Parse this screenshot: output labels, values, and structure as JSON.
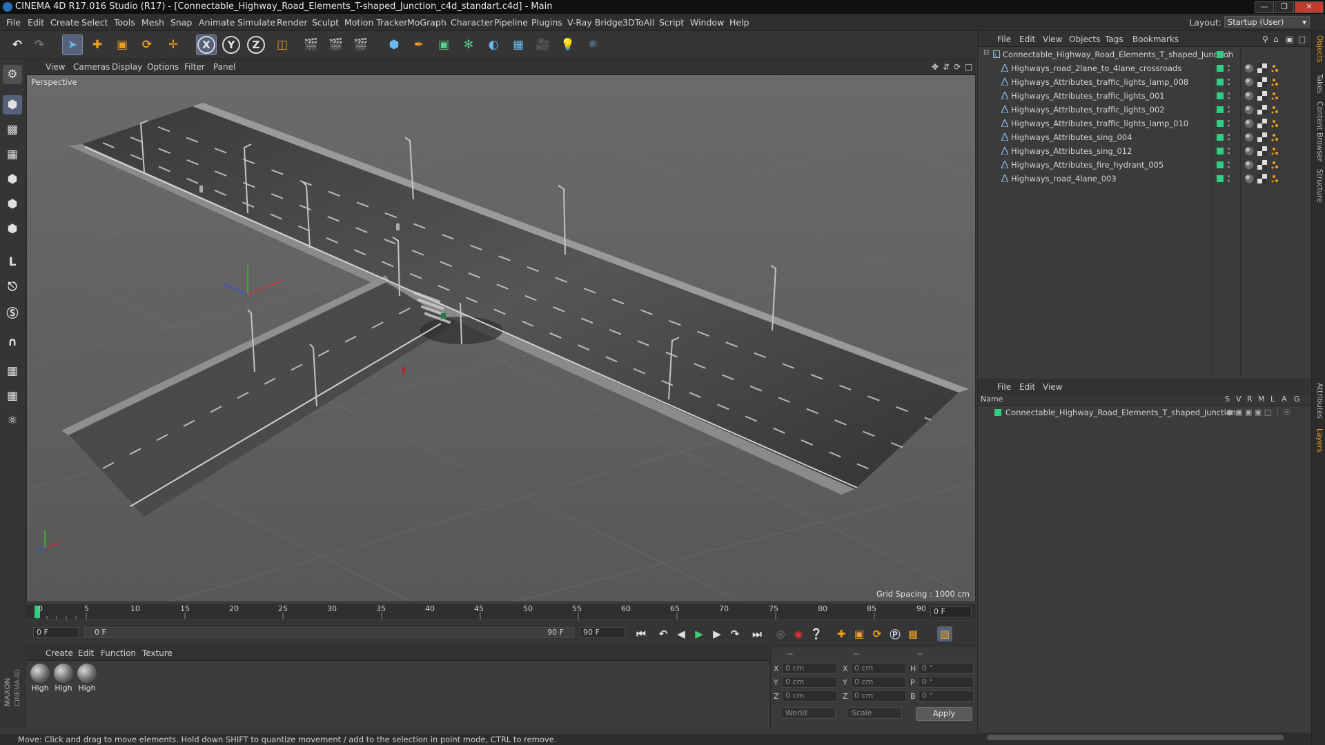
{
  "window": {
    "title": "CINEMA 4D R17.016 Studio (R17) - [Connectable_Highway_Road_Elements_T-shaped_Junction_c4d_standart.c4d] - Main"
  },
  "menubar": {
    "items": [
      "File",
      "Edit",
      "Create",
      "Select",
      "Tools",
      "Mesh",
      "Snap",
      "Animate",
      "Simulate",
      "Render",
      "Sculpt",
      "Motion Tracker",
      "MoGraph",
      "Character",
      "Pipeline",
      "Plugins",
      "V-Ray Bridge",
      "3DToAll",
      "Script",
      "Window",
      "Help"
    ],
    "layout_label": "Layout:",
    "layout_value": "Startup (User)"
  },
  "toolbar": {
    "axis_x": "X",
    "axis_y": "Y",
    "axis_z": "Z"
  },
  "viewport": {
    "menu": [
      "View",
      "Cameras",
      "Display",
      "Options",
      "Filter",
      "Panel"
    ],
    "camera_label": "Perspective",
    "grid_spacing": "Grid Spacing : 1000 cm"
  },
  "timeline": {
    "ticks": [
      "0",
      "5",
      "10",
      "15",
      "20",
      "25",
      "30",
      "35",
      "40",
      "45",
      "50",
      "55",
      "60",
      "65",
      "70",
      "75",
      "80",
      "85",
      "90"
    ],
    "end_field": "0 F",
    "start_frame": "0 F",
    "range_start": "0 F",
    "range_end": "90 F",
    "end_frame": "90 F"
  },
  "materials": {
    "menu": [
      "Create",
      "Edit",
      "Function",
      "Texture"
    ],
    "items": [
      {
        "label": "High"
      },
      {
        "label": "High"
      },
      {
        "label": "High"
      }
    ]
  },
  "coordinates": {
    "header": [
      "--",
      "--",
      "--"
    ],
    "rows": [
      {
        "a": "X",
        "av": "0 cm",
        "b": "X",
        "bv": "0 cm",
        "c": "H",
        "cv": "0 °"
      },
      {
        "a": "Y",
        "av": "0 cm",
        "b": "Y",
        "bv": "0 cm",
        "c": "P",
        "cv": "0 °"
      },
      {
        "a": "Z",
        "av": "0 cm",
        "b": "Z",
        "bv": "0 cm",
        "c": "B",
        "cv": "0 °"
      }
    ],
    "mode": "World",
    "scale": "Scale",
    "apply": "Apply"
  },
  "objects_panel": {
    "menu": [
      "File",
      "Edit",
      "View",
      "Objects",
      "Tags",
      "Bookmarks"
    ],
    "root": "Connectable_Highway_Road_Elements_T_shaped_Junction",
    "children": [
      "Highways_road_2lane_to_4lane_crossroads",
      "Highways_Attributes_traffic_lights_lamp_008",
      "Highways_Attributes_traffic_lights_001",
      "Highways_Attributes_traffic_lights_002",
      "Highways_Attributes_traffic_lights_lamp_010",
      "Highways_Attributes_sing_004",
      "Highways_Attributes_sing_012",
      "Highways_Attributes_fire_hydrant_005",
      "Highways_road_4lane_003"
    ]
  },
  "layers_panel": {
    "menu": [
      "File",
      "Edit",
      "View"
    ],
    "columns": [
      "Name",
      "S",
      "V",
      "R",
      "M",
      "L",
      "A",
      "G"
    ],
    "row": "Connectable_Highway_Road_Elements_T_shaped_Junction"
  },
  "edge_tabs": [
    "Objects",
    "Takes",
    "Content Browser",
    "Structure",
    "Attributes",
    "Layers"
  ],
  "status": {
    "text": "Move: Click and drag to move elements. Hold down SHIFT to quantize movement / add to the selection in point mode, CTRL to remove."
  },
  "colors": {
    "accent_selected": "#55627a",
    "object_visible": "#2fcf83",
    "icon_orange": "#f0a020"
  }
}
